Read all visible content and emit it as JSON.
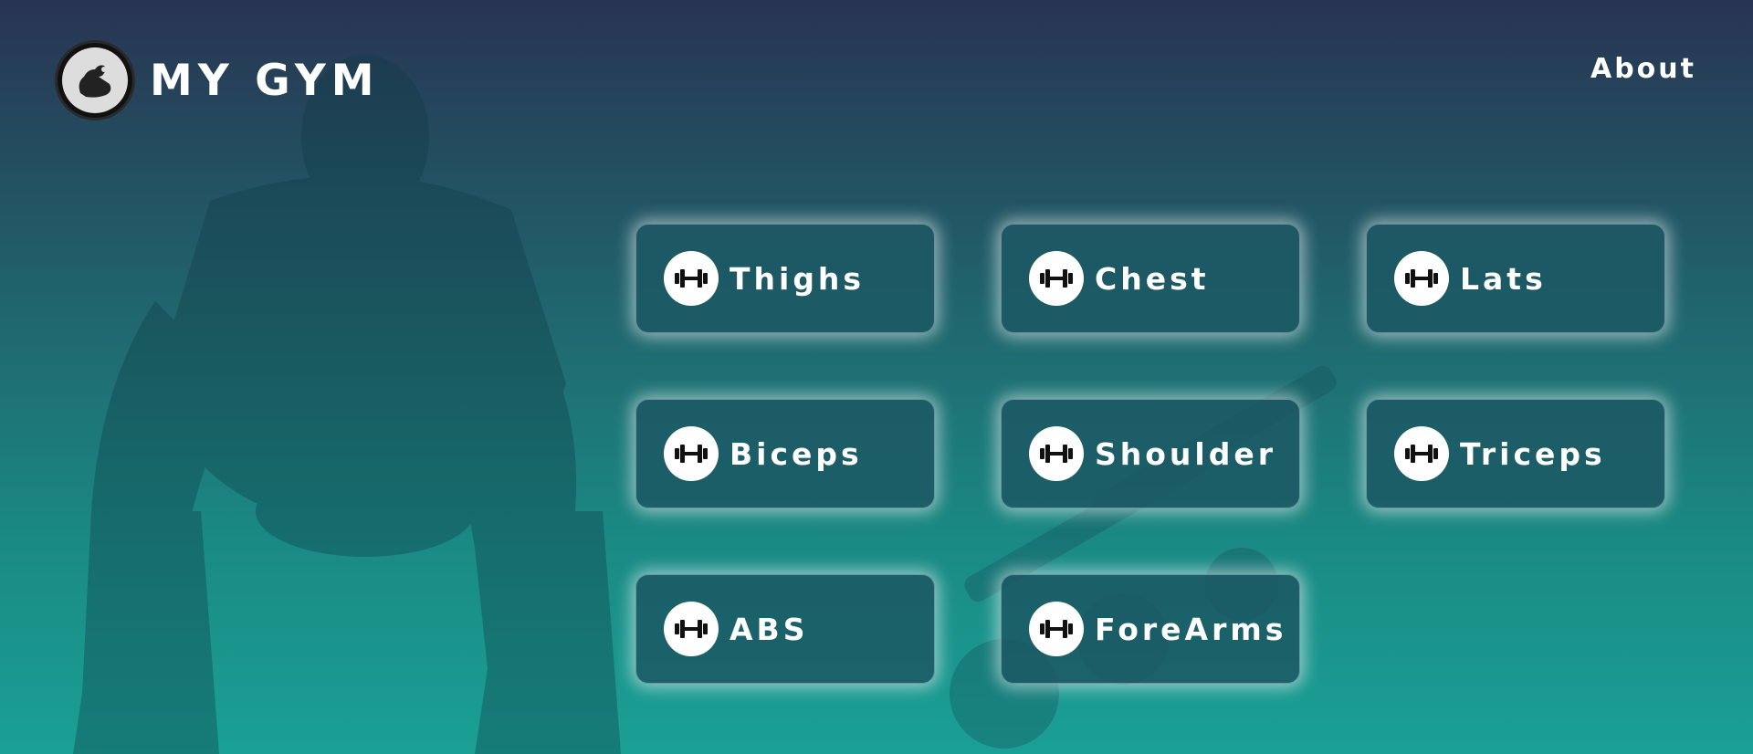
{
  "header": {
    "brand": "MY GYM",
    "nav": {
      "about_label": "About"
    }
  },
  "icons": {
    "logo": "flexing-arm-icon",
    "workout": "dumbbell-icon"
  },
  "workouts": [
    {
      "label": "Thighs"
    },
    {
      "label": "Chest"
    },
    {
      "label": "Lats"
    },
    {
      "label": "Biceps"
    },
    {
      "label": "Shoulder"
    },
    {
      "label": "Triceps"
    },
    {
      "label": "ABS"
    },
    {
      "label": "ForeArms"
    }
  ],
  "colors": {
    "gradient_top": "#283452",
    "gradient_bottom": "#1aa095",
    "card_bg": "#1c5864",
    "text": "#ffffff"
  }
}
